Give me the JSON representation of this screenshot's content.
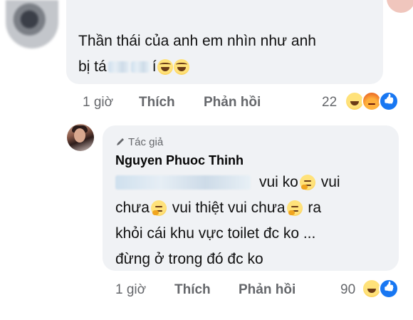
{
  "comment1": {
    "text_line1": "Thần thái của anh em nhìn như anh",
    "text_line2_start": "bị tá",
    "text_line2_end": "í",
    "time": "1 giờ",
    "like_label": "Thích",
    "reply_label": "Phản hồi",
    "reaction_count": "22",
    "reactions": [
      "haha-icon",
      "angry-icon",
      "like-icon"
    ]
  },
  "comment2": {
    "author_badge": "Tác giả",
    "author_name": "Nguyen Phuoc Thinh",
    "line1_end": "vui ko",
    "line2_a": "chưa",
    "line2_b": "vui thiệt vui chưa",
    "line2_c": "ra",
    "line3": "khỏi cái khu vực toilet đc ko ...",
    "line4": "đừng ở trong đó đc ko",
    "time": "1 giờ",
    "like_label": "Thích",
    "reply_label": "Phản hồi",
    "reaction_count": "90",
    "reactions": [
      "haha-icon",
      "like-icon"
    ]
  },
  "colors": {
    "bubble": "#f0f2f5",
    "meta_text": "#65676b",
    "like_blue": "#1877f2"
  }
}
